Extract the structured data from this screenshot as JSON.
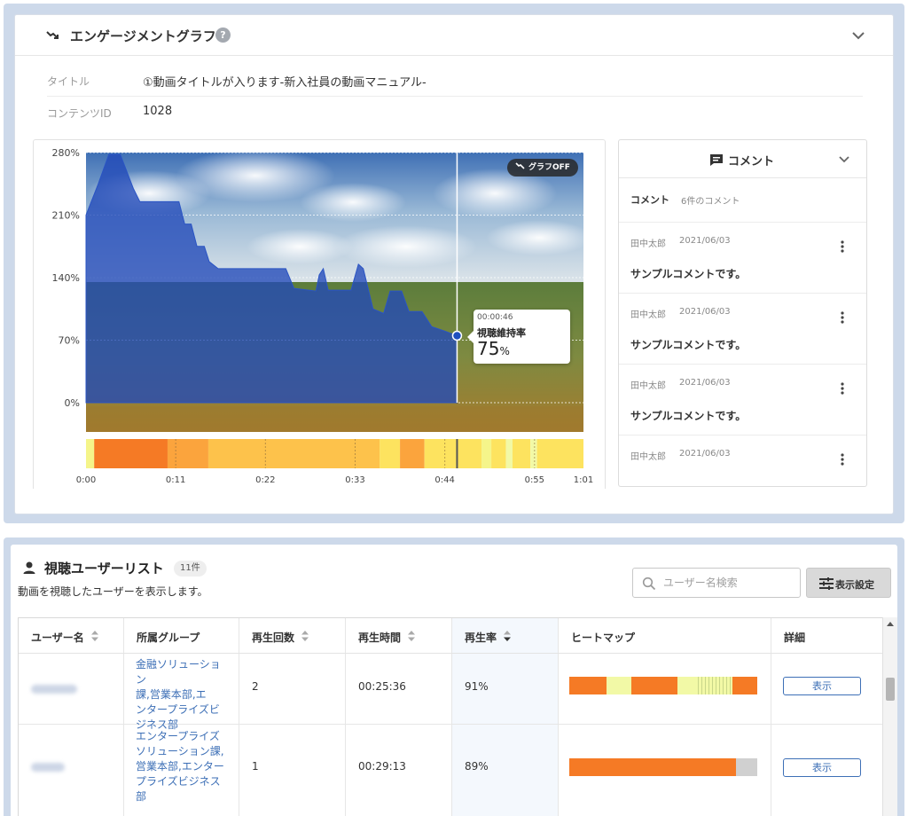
{
  "engagement": {
    "title": "エンゲージメントグラフ",
    "help_icon": "?",
    "meta": {
      "title_label": "タイトル",
      "title_value": "①動画タイトルが入ります-新入社員の動画マニュアル-",
      "id_label": "コンテンツID",
      "id_value": "1028"
    },
    "graph_off_label": "グラフOFF",
    "tooltip": {
      "time": "00:00:46",
      "label": "視聴維持率",
      "value": "75",
      "unit": "%"
    },
    "chart_data": {
      "type": "area",
      "title": "",
      "xlabel": "",
      "ylabel": "",
      "y_ticks": [
        "280%",
        "210%",
        "140%",
        "70%",
        "0%"
      ],
      "ylim": [
        0,
        280
      ],
      "x_ticks": [
        "0:00",
        "0:11",
        "0:22",
        "0:33",
        "0:44",
        "0:55",
        "1:01"
      ],
      "xlim_seconds": [
        0,
        61
      ],
      "grid": true,
      "cursor_seconds": 45.5,
      "series": [
        {
          "values": [
            [
              0,
              210
            ],
            [
              1.5,
              245
            ],
            [
              2.8,
              278
            ],
            [
              4.2,
              278
            ],
            [
              5.8,
              240
            ],
            [
              6.6,
              225
            ],
            [
              11.4,
              225
            ],
            [
              12.1,
              200
            ],
            [
              12.9,
              200
            ],
            [
              13.6,
              175
            ],
            [
              14.5,
              175
            ],
            [
              15.1,
              158
            ],
            [
              16.2,
              150
            ],
            [
              24.5,
              150
            ],
            [
              25.5,
              128
            ],
            [
              28.2,
              125
            ],
            [
              28.6,
              143
            ],
            [
              29.1,
              150
            ],
            [
              29.7,
              126
            ],
            [
              32.5,
              126
            ],
            [
              33.4,
              155
            ],
            [
              34.0,
              150
            ],
            [
              35.2,
              105
            ],
            [
              36.5,
              100
            ],
            [
              37.3,
              125
            ],
            [
              38.7,
              125
            ],
            [
              39.6,
              102
            ],
            [
              41.2,
              102
            ],
            [
              42.4,
              85
            ],
            [
              44.0,
              80
            ],
            [
              45.5,
              75
            ]
          ]
        }
      ]
    },
    "heatmap": [
      {
        "to": 1,
        "color": "#f5f58a"
      },
      {
        "to": 10,
        "color": "#f57a25"
      },
      {
        "to": 15,
        "color": "#fba43d"
      },
      {
        "to": 36,
        "color": "#fdc24b"
      },
      {
        "to": 38.5,
        "color": "#fde35f"
      },
      {
        "to": 41.5,
        "color": "#fba43d"
      },
      {
        "to": 48.5,
        "color": "#fde35f"
      },
      {
        "to": 49.7,
        "color": "#f5f58a"
      },
      {
        "to": 51.5,
        "color": "#fde35f"
      },
      {
        "to": 52.3,
        "color": "#f2f9a6"
      },
      {
        "to": 54.5,
        "color": "#fde35f"
      },
      {
        "to": 55.3,
        "color": "#f2f9a6"
      },
      {
        "to": 61,
        "color": "#fde35f"
      }
    ],
    "comments": {
      "title": "コメント",
      "count_label": "コメント",
      "count_value": "6件のコメント",
      "items": [
        {
          "user": "田中太郎",
          "date": "2021/06/03",
          "text": "サンプルコメントです。"
        },
        {
          "user": "田中太郎",
          "date": "2021/06/03",
          "text": "サンプルコメントです。"
        },
        {
          "user": "田中太郎",
          "date": "2021/06/03",
          "text": "サンプルコメントです。"
        },
        {
          "user": "田中太郎",
          "date": "2021/06/03",
          "text": ""
        }
      ]
    }
  },
  "user_list": {
    "title": "視聴ユーザーリスト",
    "count_badge": "11件",
    "description": "動画を視聴したユーザーを表示します。",
    "search_placeholder": "ユーザー名検索",
    "display_settings_label": "表示設定",
    "columns": {
      "name": "ユーザー名",
      "group": "所属グループ",
      "plays": "再生回数",
      "duration": "再生時間",
      "rate": "再生率",
      "heatmap": "ヒートマップ",
      "detail": "詳細"
    },
    "rows": [
      {
        "group": [
          "金融ソリューション",
          "課,営業本部,エ",
          "ンタープライズビ",
          "ジネス部"
        ],
        "plays": "2",
        "duration": "00:25:36",
        "rate": "91%",
        "detail_label": "表示",
        "heatmap": [
          {
            "w": 42,
            "c": "#f57a25"
          },
          {
            "w": 28,
            "c": "#f2f9a6"
          },
          {
            "w": 52,
            "c": "#f57a25"
          },
          {
            "w": 20,
            "c": "#f2f9a6"
          },
          {
            "w": 42,
            "c": "stripe"
          },
          {
            "w": 28,
            "c": "#f57a25"
          }
        ]
      },
      {
        "group": [
          "エンタープライズ",
          "ソリューション課,",
          "営業本部,エンター",
          "プライズビジネス",
          "部"
        ],
        "plays": "1",
        "duration": "00:29:13",
        "rate": "89%",
        "detail_label": "表示",
        "heatmap": [
          {
            "w": 188,
            "c": "#f57a25"
          },
          {
            "w": 24,
            "c": "#d0d0d0"
          }
        ]
      }
    ]
  }
}
